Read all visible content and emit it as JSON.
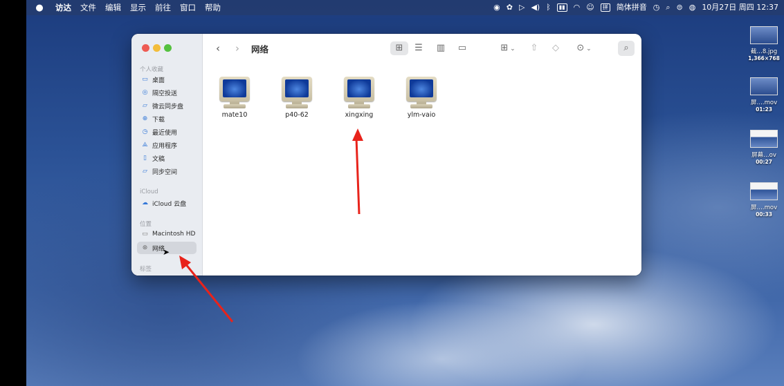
{
  "menubar": {
    "apple": "",
    "items": [
      "访达",
      "文件",
      "编辑",
      "显示",
      "前往",
      "窗口",
      "帮助"
    ],
    "input_method": "简体拼音",
    "datetime": "10月27日 周四  12:37"
  },
  "finder": {
    "title": "网络",
    "sidebar": {
      "favorites_title": "个人收藏",
      "favorites": [
        {
          "label": "桌面",
          "icon": "desktop-icon"
        },
        {
          "label": "隔空投送",
          "icon": "airdrop-icon"
        },
        {
          "label": "微云同步盘",
          "icon": "folder-icon"
        },
        {
          "label": "下载",
          "icon": "download-icon"
        },
        {
          "label": "最近使用",
          "icon": "clock-icon"
        },
        {
          "label": "应用程序",
          "icon": "apps-icon"
        },
        {
          "label": "文稿",
          "icon": "document-icon"
        },
        {
          "label": "同步空间",
          "icon": "folder-icon"
        }
      ],
      "icloud_title": "iCloud",
      "icloud": [
        {
          "label": "iCloud 云盘",
          "icon": "cloud-icon"
        }
      ],
      "locations_title": "位置",
      "locations": [
        {
          "label": "Macintosh HD",
          "icon": "disk-icon"
        },
        {
          "label": "网络",
          "icon": "globe-icon",
          "selected": true
        }
      ],
      "tags_title": "标签"
    },
    "computers": [
      {
        "name": "mate10"
      },
      {
        "name": "p40-62"
      },
      {
        "name": "xingxing"
      },
      {
        "name": "ylm-vaio"
      }
    ]
  },
  "desktop": {
    "files": [
      {
        "name": "截…8.jpg",
        "sub": "1,366×768"
      },
      {
        "name": "屏….mov",
        "sub": "01:23"
      },
      {
        "name": "屏幕…ov",
        "sub": "00:27"
      },
      {
        "name": "屏….mov",
        "sub": "00:33"
      }
    ]
  },
  "colors": {
    "annotation_arrow": "#e8231b",
    "sidebar_accent": "#3478d8"
  }
}
